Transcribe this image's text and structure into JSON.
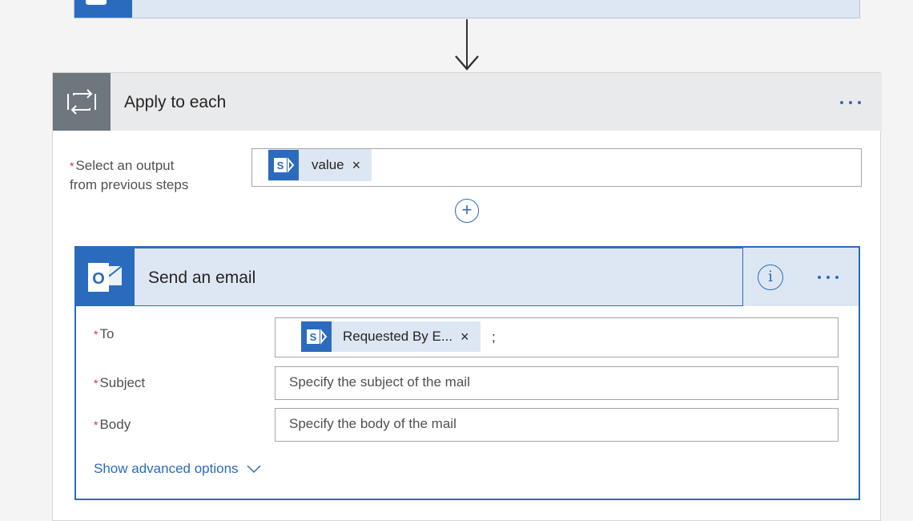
{
  "apply": {
    "title": "Apply to each",
    "output_label": "Select an output\nfrom previous steps",
    "output_label_line1": "Select an output",
    "output_label_line2": "from previous steps",
    "token_value": "value",
    "token_remove": "×",
    "add_symbol": "+"
  },
  "email": {
    "title": "Send an email",
    "info_symbol": "i",
    "to_label": "To",
    "to_token": "Requested By E...",
    "to_token_remove": "×",
    "to_separator": ";",
    "subject_label": "Subject",
    "subject_placeholder": "Specify the subject of the mail",
    "body_label": "Body",
    "body_placeholder": "Specify the body of the mail",
    "advanced_link": "Show advanced options"
  },
  "required_marker": "*",
  "colors": {
    "accent": "#2b6bbd",
    "header_bg": "#dde7f4",
    "loop_icon_bg": "#6e767e",
    "required": "#d13438"
  },
  "icons": {
    "sharepoint": "sharepoint-icon",
    "loop": "loop-icon",
    "outlook": "outlook-icon",
    "info": "info-icon",
    "more": "more-icon",
    "chevron": "chevron-down-icon",
    "arrow": "arrow-down-icon"
  }
}
